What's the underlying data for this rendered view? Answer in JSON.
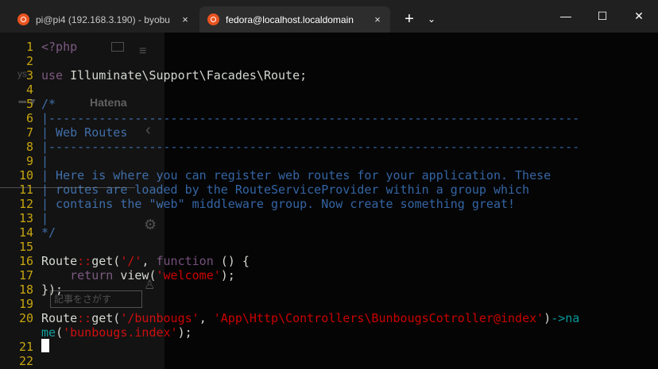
{
  "tabs": [
    {
      "title": "pi@pi4 (192.168.3.190) - byobu",
      "close": "×",
      "icon": "ubuntu-icon",
      "active": false
    },
    {
      "title": "fedora@localhost.localdomain",
      "close": "×",
      "icon": "ubuntu-icon",
      "active": true
    }
  ],
  "toolbar": {
    "new_tab": "+",
    "dropdown": "⌄"
  },
  "window": {
    "minimize": "—",
    "maximize": "☐",
    "close": "✕"
  },
  "colors": {
    "line_number": "#c4a000",
    "keyword": "#75507b",
    "string": "#cc0000",
    "comment": "#3465a4",
    "arrow": "#06989a",
    "text": "#d3d7cf"
  },
  "editor": {
    "lines": [
      {
        "n": "1",
        "tokens": [
          {
            "t": "<?php",
            "c": "kw"
          }
        ]
      },
      {
        "n": "2",
        "tokens": []
      },
      {
        "n": "3",
        "tokens": [
          {
            "t": "use",
            "c": "kw"
          },
          {
            "t": " Illuminate\\Support\\Facades\\Route;",
            "c": ""
          }
        ]
      },
      {
        "n": "4",
        "tokens": []
      },
      {
        "n": "5",
        "tokens": [
          {
            "t": "/*",
            "c": "cm"
          }
        ]
      },
      {
        "n": "6",
        "tokens": [
          {
            "t": "|--------------------------------------------------------------------------",
            "c": "cm"
          }
        ]
      },
      {
        "n": "7",
        "tokens": [
          {
            "t": "| Web Routes",
            "c": "cm"
          }
        ]
      },
      {
        "n": "8",
        "tokens": [
          {
            "t": "|--------------------------------------------------------------------------",
            "c": "cm"
          }
        ]
      },
      {
        "n": "9",
        "tokens": [
          {
            "t": "|",
            "c": "cm"
          }
        ]
      },
      {
        "n": "10",
        "tokens": [
          {
            "t": "| Here is where you can register web routes for your application. These",
            "c": "cm"
          }
        ]
      },
      {
        "n": "11",
        "tokens": [
          {
            "t": "| routes are loaded by the RouteServiceProvider within a group which",
            "c": "cm"
          }
        ]
      },
      {
        "n": "12",
        "tokens": [
          {
            "t": "| contains the \"web\" middleware group. Now create something great!",
            "c": "cm"
          }
        ]
      },
      {
        "n": "13",
        "tokens": [
          {
            "t": "|",
            "c": "cm"
          }
        ]
      },
      {
        "n": "14",
        "tokens": [
          {
            "t": "*/",
            "c": "cm"
          }
        ]
      },
      {
        "n": "15",
        "tokens": []
      },
      {
        "n": "16",
        "tokens": [
          {
            "t": "Route",
            "c": ""
          },
          {
            "t": "::",
            "c": "punc"
          },
          {
            "t": "get(",
            "c": ""
          },
          {
            "t": "'/'",
            "c": "str"
          },
          {
            "t": ", ",
            "c": ""
          },
          {
            "t": "function",
            "c": "kw"
          },
          {
            "t": " () {",
            "c": ""
          }
        ]
      },
      {
        "n": "17",
        "tokens": [
          {
            "t": "    ",
            "c": ""
          },
          {
            "t": "return",
            "c": "kw"
          },
          {
            "t": " view(",
            "c": ""
          },
          {
            "t": "'welcome'",
            "c": "str"
          },
          {
            "t": ");",
            "c": ""
          }
        ]
      },
      {
        "n": "18",
        "tokens": [
          {
            "t": "});",
            "c": ""
          }
        ]
      },
      {
        "n": "19",
        "tokens": []
      },
      {
        "n": "20",
        "tokens": [
          {
            "t": "Route",
            "c": ""
          },
          {
            "t": "::",
            "c": "punc"
          },
          {
            "t": "get(",
            "c": ""
          },
          {
            "t": "'/bunbougs'",
            "c": "str"
          },
          {
            "t": ", ",
            "c": ""
          },
          {
            "t": "'App\\Http\\Controllers\\BunbougsCotroller@index'",
            "c": "str"
          },
          {
            "t": ")",
            "c": ""
          },
          {
            "t": "->",
            "c": "op"
          },
          {
            "t": "na",
            "c": "op"
          }
        ]
      },
      {
        "n": "",
        "tokens": [
          {
            "t": "me",
            "c": "op"
          },
          {
            "t": "(",
            "c": ""
          },
          {
            "t": "'bunbougs.index'",
            "c": "str"
          },
          {
            "t": ");",
            "c": ""
          }
        ]
      },
      {
        "n": "21",
        "tokens": []
      },
      {
        "n": "22",
        "tokens": []
      }
    ]
  },
  "ghost": {
    "ys": "ys",
    "hatena": "Hatena",
    "grid": "▪▪▪ ▼",
    "search": "記事をさがす",
    "back": "‹",
    "menu": "≡",
    "gear": "⚙",
    "user": "♙"
  }
}
